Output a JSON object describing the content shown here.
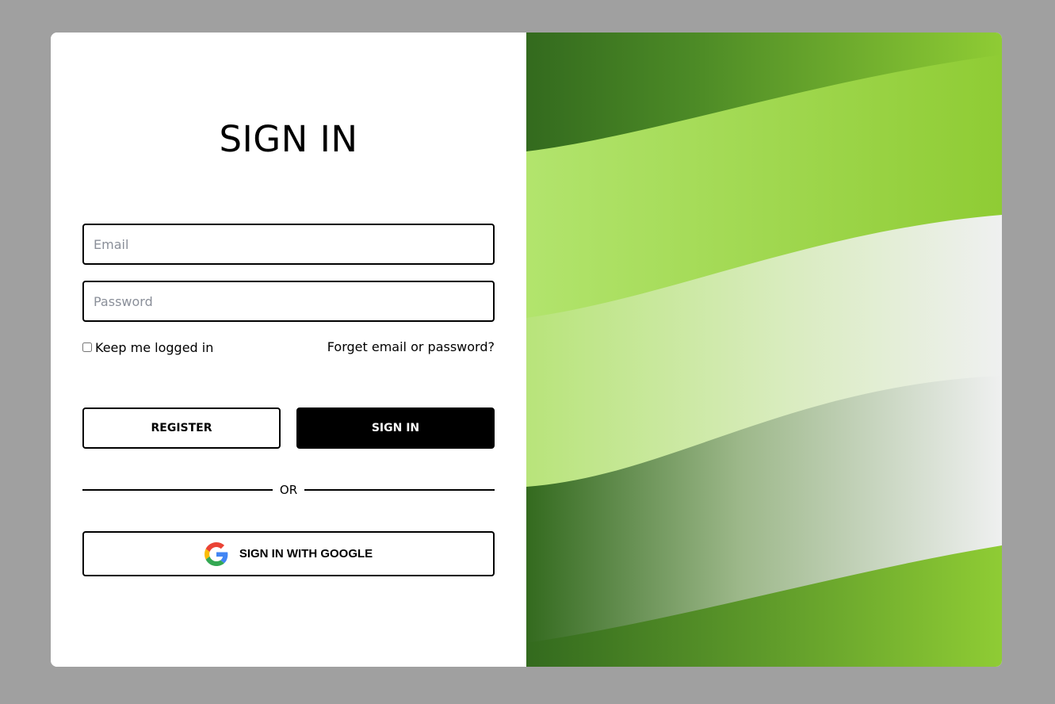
{
  "login": {
    "title": "SIGN IN",
    "email_placeholder": "Email",
    "password_placeholder": "Password",
    "remember_label": "Keep me logged in",
    "forgot_label": "Forget email or password?",
    "register_label": "REGISTER",
    "signin_label": "SIGN IN",
    "divider_label": "OR",
    "google_label": "SIGN IN WITH GOOGLE"
  },
  "colors": {
    "page_background": "#a0a0a0",
    "card_background": "#ffffff",
    "primary_button": "#000000",
    "dark_green": "#336a1e",
    "bright_green": "#8fcc34",
    "light_green": "#b2e46d",
    "pale_gray": "#eff0f0"
  },
  "icons": {
    "google": "google-g-logo"
  }
}
